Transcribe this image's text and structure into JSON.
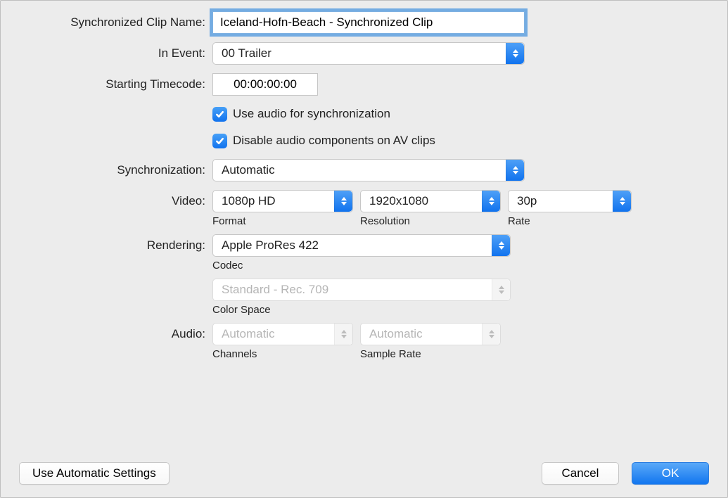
{
  "labels": {
    "clip_name": "Synchronized Clip Name:",
    "in_event": "In Event:",
    "starting_timecode": "Starting Timecode:",
    "synchronization": "Synchronization:",
    "video": "Video:",
    "rendering": "Rendering:",
    "audio": "Audio:"
  },
  "fields": {
    "clip_name_value": "Iceland-Hofn-Beach - Synchronized Clip",
    "in_event_value": "00 Trailer",
    "starting_timecode_value": "00:00:00:00",
    "use_audio_sync": "Use audio for synchronization",
    "disable_audio_components": "Disable audio components on AV clips",
    "synchronization_value": "Automatic",
    "video_format_value": "1080p HD",
    "video_resolution_value": "1920x1080",
    "video_rate_value": "30p",
    "rendering_codec_value": "Apple ProRes 422",
    "color_space_value": "Standard - Rec. 709",
    "audio_channels_value": "Automatic",
    "audio_sample_rate_value": "Automatic"
  },
  "sublabels": {
    "format": "Format",
    "resolution": "Resolution",
    "rate": "Rate",
    "codec": "Codec",
    "color_space": "Color Space",
    "channels": "Channels",
    "sample_rate": "Sample Rate"
  },
  "buttons": {
    "use_auto": "Use Automatic Settings",
    "cancel": "Cancel",
    "ok": "OK"
  }
}
